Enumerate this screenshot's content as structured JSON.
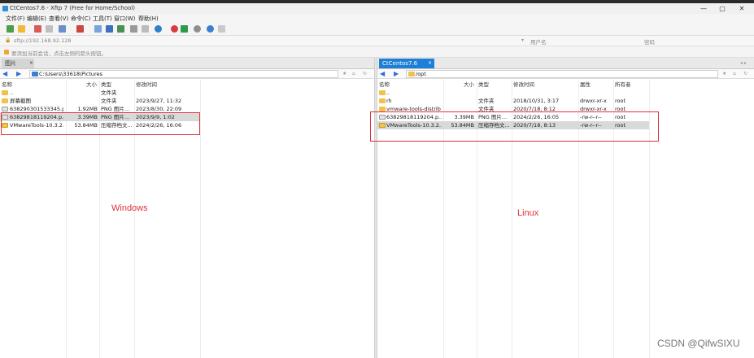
{
  "window": {
    "title": "CtCentos7.6 - Xftp 7 (Free for Home/School)",
    "controls": [
      "—",
      "▢",
      "✕"
    ]
  },
  "menu": [
    "文件(F)",
    "编辑(E)",
    "查看(V)",
    "命令(C)",
    "工具(T)",
    "窗口(W)",
    "帮助(H)"
  ],
  "address": {
    "url": "sftp://192.168.92.128",
    "username_placeholder": "用户名",
    "password_placeholder": "密码"
  },
  "hint": "要添加当前会话，点击左侧的箭头按钮。",
  "left_pane": {
    "tab": "图片",
    "path": "C:\\Users\\33618\\Pictures",
    "columns": [
      "名称",
      "大小",
      "类型",
      "修改时间"
    ],
    "rows": [
      {
        "name": "..",
        "size": "",
        "type": "文件夹",
        "modified": "",
        "icon": "folder",
        "selected": false
      },
      {
        "name": "屏幕截图",
        "size": "",
        "type": "文件夹",
        "modified": "2023/9/27, 11:32",
        "icon": "folder",
        "selected": false
      },
      {
        "name": "638290301533345.p...",
        "size": "1.92MB",
        "type": "PNG 图片...",
        "modified": "2023/8/30, 22:09",
        "icon": "img",
        "selected": false
      },
      {
        "name": "63829818119204.p...",
        "size": "3.39MB",
        "type": "PNG 图片...",
        "modified": "2023/9/9, 1:02",
        "icon": "img",
        "selected": true
      },
      {
        "name": "VMwareTools-10.3.2...",
        "size": "53.84MB",
        "type": "压缩存档文...",
        "modified": "2024/2/26, 16:06",
        "icon": "zip",
        "selected": false
      }
    ],
    "annotation": "Windows"
  },
  "right_pane": {
    "tab": "CtCentos7.6",
    "path": "/opt",
    "columns": [
      "名称",
      "大小",
      "类型",
      "修改时间",
      "属性",
      "所有者"
    ],
    "rows": [
      {
        "name": "..",
        "size": "",
        "type": "",
        "modified": "",
        "perm": "",
        "owner": "",
        "icon": "folder",
        "selected": false
      },
      {
        "name": "rh",
        "size": "",
        "type": "文件夹",
        "modified": "2018/10/31, 3:17",
        "perm": "drwxr-xr-x",
        "owner": "root",
        "icon": "folder",
        "selected": false
      },
      {
        "name": "vmware-tools-distrib",
        "size": "",
        "type": "文件夹",
        "modified": "2020/7/18, 8:12",
        "perm": "drwxr-xr-x",
        "owner": "root",
        "icon": "folder",
        "selected": false
      },
      {
        "name": "63829818119204.p...",
        "size": "3.39MB",
        "type": "PNG 图片...",
        "modified": "2024/2/26, 16:05",
        "perm": "-rw-r--r--",
        "owner": "root",
        "icon": "img",
        "selected": false
      },
      {
        "name": "VMwareTools-10.3.2...",
        "size": "53.84MB",
        "type": "压缩存档文...",
        "modified": "2020/7/18, 8:13",
        "perm": "-rw-r--r--",
        "owner": "root",
        "icon": "zip",
        "selected": true
      }
    ],
    "annotation": "Linux"
  },
  "watermark": "CSDN @QifwSIXU",
  "colors": {
    "tab_active": "#1e7fd6",
    "annotation": "#e0323a",
    "selection": "#d9d9d9"
  }
}
